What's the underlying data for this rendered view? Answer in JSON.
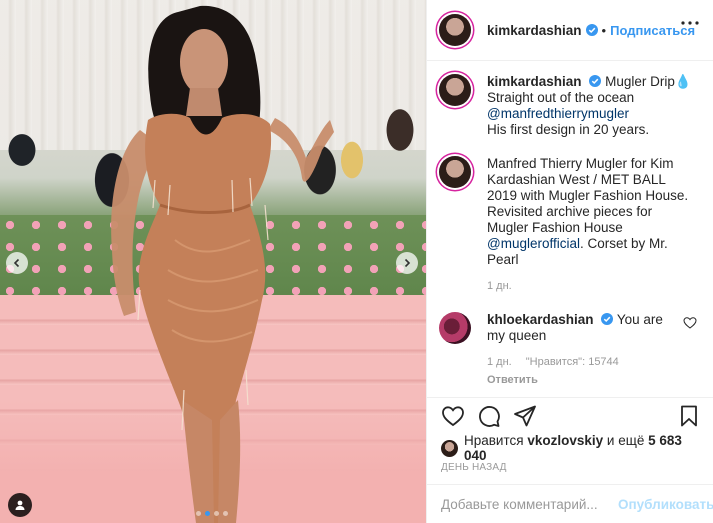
{
  "post": {
    "author": "kimkardashian",
    "separator": "•",
    "follow_label": "Подписаться",
    "photo_alt": "Kim Kardashian at Met Gala 2019 in Mugler dress",
    "carousel_total": 4,
    "carousel_active": 1
  },
  "comments": [
    {
      "username": "kimkardashian",
      "verified": true,
      "lines": [
        "Mugler Drip💧",
        "Straight out of the ocean"
      ],
      "mention": "@manfredthierrymugler",
      "tail": "His first design in 20 years."
    },
    {
      "username": "",
      "verified": false,
      "text_a": "Manfred Thierry Mugler for Kim Kardashian West / MET BALL 2019 with Mugler Fashion House. Revisited archive pieces for Mugler Fashion House ",
      "mention": "@muglerofficial",
      "text_b": ". Corset by Mr. Pearl",
      "time": "1 дн."
    },
    {
      "username": "khloekardashian",
      "verified": true,
      "text": "You are my queen",
      "time": "1 дн.",
      "likes": "\"Нравится\": 15744",
      "reply_label": "Ответить"
    }
  ],
  "likes": {
    "prefix": "Нравится",
    "user": "vkozlovskiy",
    "suffix": "и ещё",
    "count": "5 683 040"
  },
  "date_label": "ДЕНЬ НАЗАД",
  "add_comment": {
    "placeholder": "Добавьте комментарий...",
    "post_label": "Опубликовать"
  },
  "icons": {
    "verified": "verified-badge-icon",
    "more": "more-options-icon",
    "heart": "heart-icon",
    "comment": "comment-bubble-icon",
    "share": "share-paper-plane-icon",
    "save": "bookmark-icon",
    "user_tag": "user-tag-icon",
    "prev": "chevron-left-icon",
    "next": "chevron-right-icon"
  },
  "colors": {
    "link": "#003569",
    "accent": "#3897f0",
    "muted": "#999999",
    "post_disabled": "#b2dffc"
  }
}
